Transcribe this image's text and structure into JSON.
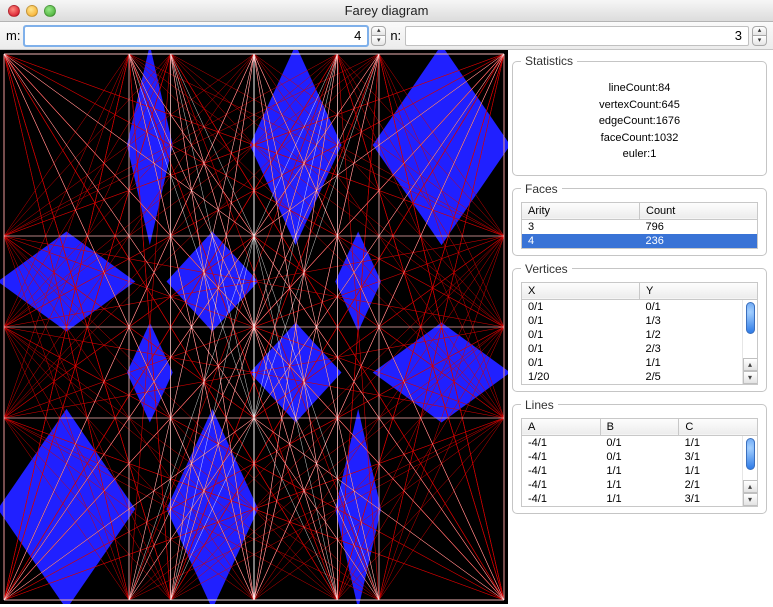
{
  "window": {
    "title": "Farey diagram"
  },
  "inputs": {
    "m_label": "m:",
    "m_value": "4",
    "n_label": "n:",
    "n_value": "3"
  },
  "statistics": {
    "legend": "Statistics",
    "lineCount": "lineCount:84",
    "vertexCount": "vertexCount:645",
    "edgeCount": "edgeCount:1676",
    "faceCount": "faceCount:1032",
    "euler": "euler:1"
  },
  "faces": {
    "legend": "Faces",
    "cols": {
      "arity": "Arity",
      "count": "Count"
    },
    "rows": [
      {
        "arity": "3",
        "count": "796",
        "sel": false
      },
      {
        "arity": "4",
        "count": "236",
        "sel": true
      }
    ]
  },
  "vertices": {
    "legend": "Vertices",
    "cols": {
      "x": "X",
      "y": "Y"
    },
    "rows": [
      {
        "x": "0/1",
        "y": "0/1"
      },
      {
        "x": "0/1",
        "y": "1/3"
      },
      {
        "x": "0/1",
        "y": "1/2"
      },
      {
        "x": "0/1",
        "y": "2/3"
      },
      {
        "x": "0/1",
        "y": "1/1"
      },
      {
        "x": "1/20",
        "y": "2/5"
      }
    ]
  },
  "lines": {
    "legend": "Lines",
    "cols": {
      "a": "A",
      "b": "B",
      "c": "C"
    },
    "rows": [
      {
        "a": "-4/1",
        "b": "0/1",
        "c": "1/1"
      },
      {
        "a": "-4/1",
        "b": "0/1",
        "c": "3/1"
      },
      {
        "a": "-4/1",
        "b": "1/1",
        "c": "1/1"
      },
      {
        "a": "-4/1",
        "b": "1/1",
        "c": "2/1"
      },
      {
        "a": "-4/1",
        "b": "1/1",
        "c": "3/1"
      }
    ]
  },
  "diagram": {
    "grid_denoms": [
      1,
      2,
      3,
      4
    ],
    "colors": {
      "red": "#d10000",
      "white": "#ffffff",
      "blue": "#2020ff",
      "black": "#000000"
    }
  }
}
